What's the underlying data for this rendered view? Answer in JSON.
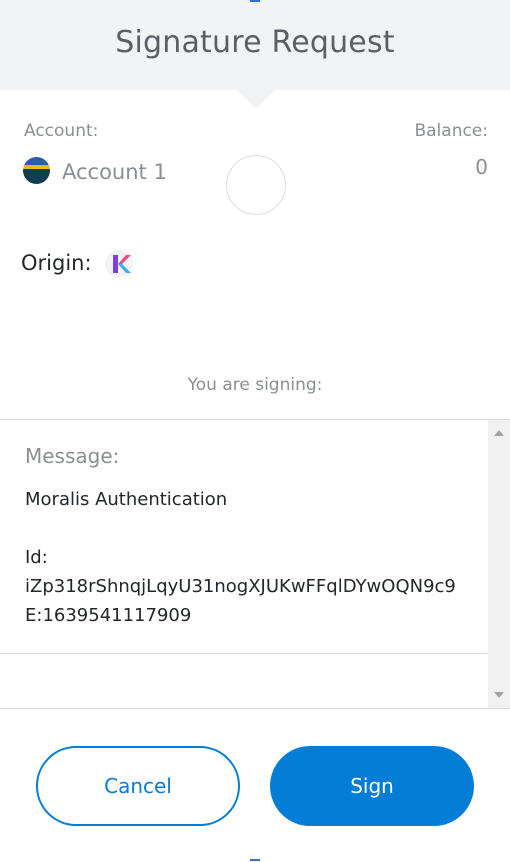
{
  "header": {
    "title": "Signature Request"
  },
  "account": {
    "label": "Account:",
    "name": "Account 1"
  },
  "balance": {
    "label": "Balance:",
    "value": "0"
  },
  "origin": {
    "label": "Origin:"
  },
  "signing": {
    "label": "You are signing:"
  },
  "message": {
    "label": "Message:",
    "body": "Moralis Authentication\n\nId:\niZp318rShnqjLqyU31nogXJUKwFFqlDYwOQN9c9E:1639541117909"
  },
  "buttons": {
    "cancel": "Cancel",
    "sign": "Sign"
  },
  "colors": {
    "accent": "#037dd6",
    "header_bg": "#f2f3f4"
  }
}
